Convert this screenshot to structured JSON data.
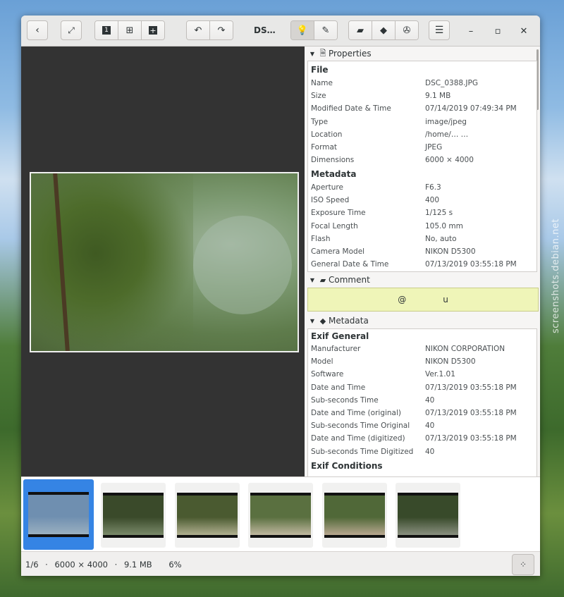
{
  "watermark": "screenshots.debian.net",
  "header": {
    "title": "DS…",
    "icons": {
      "back": "back-icon",
      "fullscreen": "fullscreen-icon",
      "view_one": "1",
      "view_fit": "⊞",
      "view_add": "+"
    }
  },
  "properties": {
    "header": "Properties",
    "file_title": "File",
    "file_rows": [
      {
        "k": "Name",
        "v": "DSC_0388.JPG"
      },
      {
        "k": "Size",
        "v": "9.1 MB"
      },
      {
        "k": "Modified Date & Time",
        "v": "07/14/2019 07:49:34 PM"
      },
      {
        "k": "Type",
        "v": "image/jpeg"
      },
      {
        "k": "Location",
        "v": "/home/… …"
      },
      {
        "k": "Format",
        "v": "JPEG"
      },
      {
        "k": "Dimensions",
        "v": "6000 × 4000"
      }
    ],
    "meta_title": "Metadata",
    "meta_rows": [
      {
        "k": "Aperture",
        "v": "F6.3"
      },
      {
        "k": "ISO Speed",
        "v": "400"
      },
      {
        "k": "Exposure Time",
        "v": "1/125 s"
      },
      {
        "k": "Focal Length",
        "v": "105.0 mm"
      },
      {
        "k": "Flash",
        "v": "No, auto"
      },
      {
        "k": "Camera Model",
        "v": "NIKON D5300"
      },
      {
        "k": "General Date & Time",
        "v": "07/13/2019 03:55:18 PM"
      }
    ]
  },
  "comment": {
    "header": "Comment",
    "text_a": "@",
    "text_b": "u"
  },
  "metadata": {
    "header": "Metadata",
    "exif_general_title": "Exif General",
    "exif_rows": [
      {
        "k": "Manufacturer",
        "v": "NIKON CORPORATION"
      },
      {
        "k": "Model",
        "v": "NIKON D5300"
      },
      {
        "k": "Software",
        "v": "Ver.1.01"
      },
      {
        "k": "Date and Time",
        "v": "07/13/2019 03:55:18 PM"
      },
      {
        "k": "Sub-seconds Time",
        "v": "40"
      },
      {
        "k": "Date and Time (original)",
        "v": "07/13/2019 03:55:18 PM"
      },
      {
        "k": "Sub-seconds Time Original",
        "v": "40"
      },
      {
        "k": "Date and Time (digitized)",
        "v": "07/13/2019 03:55:18 PM"
      },
      {
        "k": "Sub-seconds Time Digitized",
        "v": "40"
      }
    ],
    "exif_conditions_title": "Exif Conditions"
  },
  "thumbnails": [
    {
      "selected": true,
      "colors": [
        "#6f8fb0",
        "#9ab0c0"
      ]
    },
    {
      "selected": false,
      "colors": [
        "#3a4a2a",
        "#7a8a6a"
      ]
    },
    {
      "selected": false,
      "colors": [
        "#4a5a30",
        "#b0b090"
      ]
    },
    {
      "selected": false,
      "colors": [
        "#5a7040",
        "#c0b8a0"
      ]
    },
    {
      "selected": false,
      "colors": [
        "#506838",
        "#b8a890"
      ]
    },
    {
      "selected": false,
      "colors": [
        "#384a2a",
        "#8a9080"
      ]
    }
  ],
  "status": {
    "position": "1/6",
    "dimensions": "6000 × 4000",
    "size": "9.1 MB",
    "zoom": "6%"
  }
}
